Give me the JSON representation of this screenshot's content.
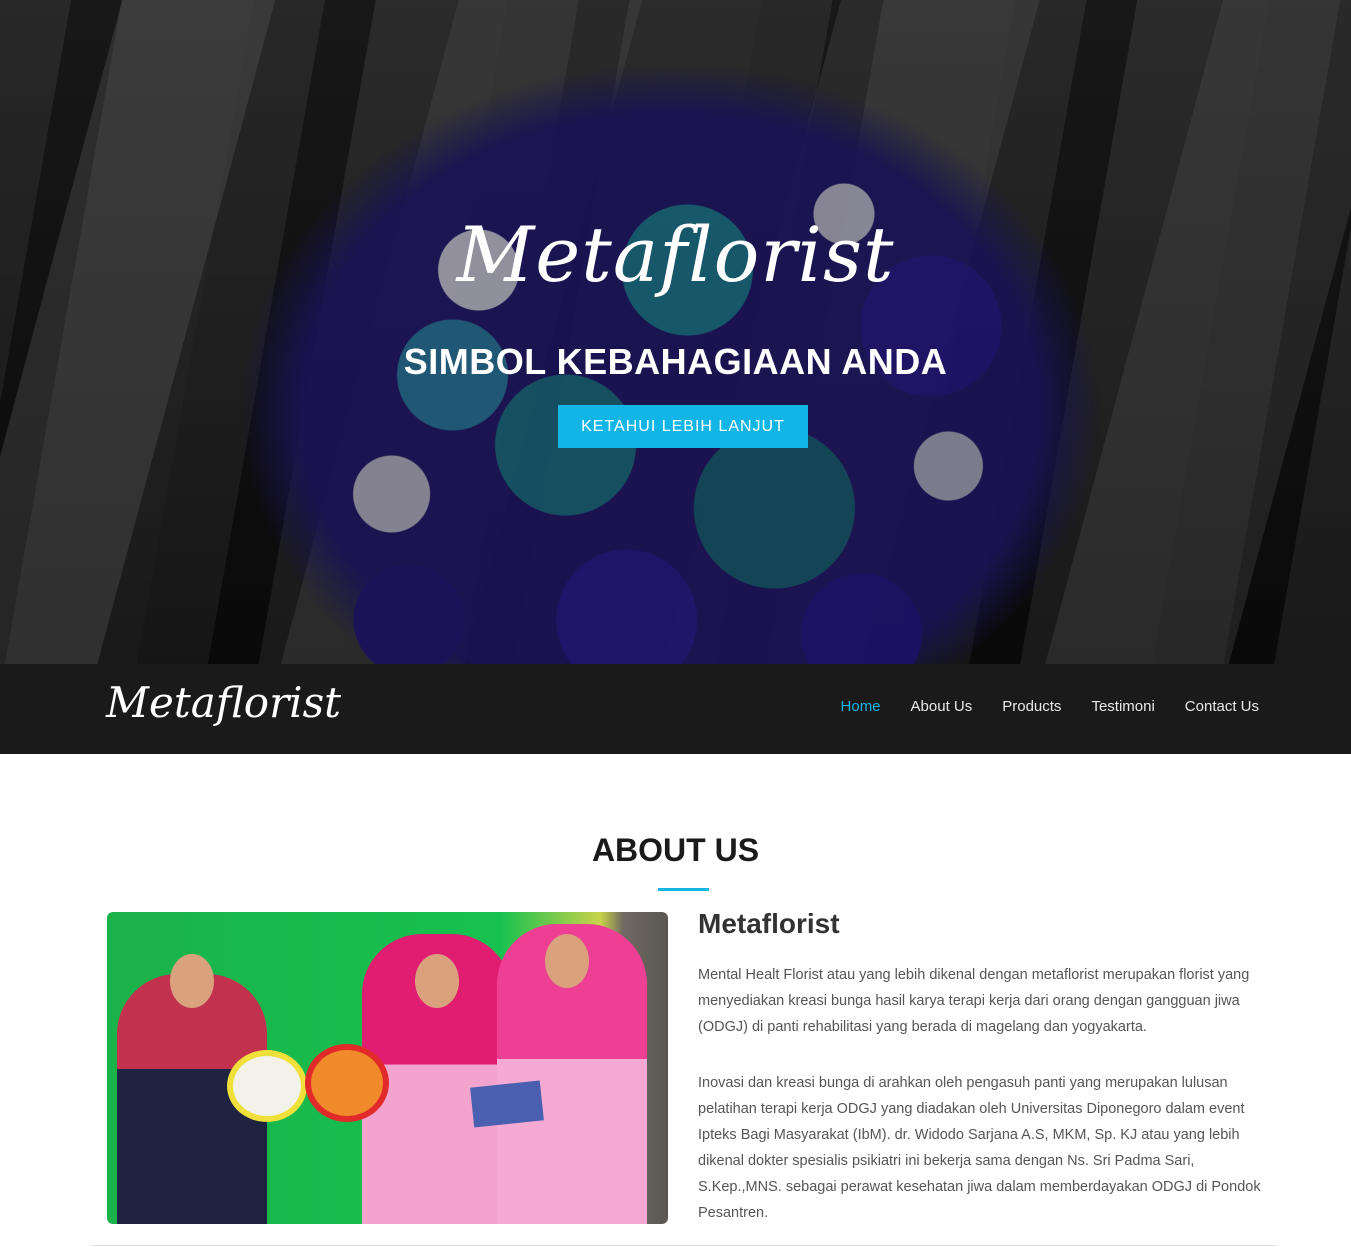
{
  "hero": {
    "brand": "Metaflorist",
    "tagline": "SIMBOL KEBAHAGIAAN ANDA",
    "cta_label": "KETAHUI LEBIH LANJUT"
  },
  "navbar": {
    "brand": "Metaflorist",
    "items": [
      {
        "label": "Home",
        "active": true
      },
      {
        "label": "About Us"
      },
      {
        "label": "Products"
      },
      {
        "label": "Testimoni"
      },
      {
        "label": "Contact Us"
      }
    ]
  },
  "about": {
    "section_title": "ABOUT US",
    "heading": "Metaflorist",
    "paragraphs": [
      "Mental Healt Florist atau yang lebih dikenal dengan metaflorist merupakan florist yang menyediakan kreasi bunga hasil karya terapi kerja dari orang dengan gangguan jiwa (ODGJ) di panti rehabilitasi yang berada di magelang dan yogyakarta.",
      "Inovasi dan kreasi bunga di arahkan oleh pengasuh panti yang merupakan lulusan pelatihan terapi kerja ODGJ yang diadakan oleh Universitas Diponegoro dalam event Ipteks Bagi Masyarakat (IbM). dr. Widodo Sarjana A.S, MKM, Sp. KJ atau yang lebih dikenal dokter spesialis psikiatri ini bekerja sama dengan Ns. Sri Padma Sari, S.Kep.,MNS. sebagai perawat kesehatan jiwa dalam memberdayakan ODGJ di Pondok Pesantren."
    ]
  },
  "colors": {
    "accent": "#12b5e6",
    "navbar_bg": "#1a1a1a"
  }
}
